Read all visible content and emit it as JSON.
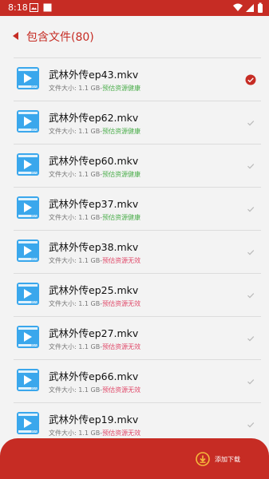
{
  "status_bar": {
    "time": "8:18"
  },
  "header": {
    "title": "包含文件(80)"
  },
  "files": [
    {
      "name": "武林外传ep43.mkv",
      "size_text": "文件大小: 1.1 GB-",
      "health_text": "预估资源健康",
      "health": "ok",
      "checked": true
    },
    {
      "name": "武林外传ep62.mkv",
      "size_text": "文件大小: 1.1 GB-",
      "health_text": "预估资源健康",
      "health": "ok",
      "checked": false
    },
    {
      "name": "武林外传ep60.mkv",
      "size_text": "文件大小: 1.1 GB-",
      "health_text": "预估资源健康",
      "health": "ok",
      "checked": false
    },
    {
      "name": "武林外传ep37.mkv",
      "size_text": "文件大小: 1.1 GB-",
      "health_text": "预估资源健康",
      "health": "ok",
      "checked": false
    },
    {
      "name": "武林外传ep38.mkv",
      "size_text": "文件大小: 1.1 GB-",
      "health_text": "预估资源无效",
      "health": "bad",
      "checked": false
    },
    {
      "name": "武林外传ep25.mkv",
      "size_text": "文件大小: 1.1 GB-",
      "health_text": "预估资源无效",
      "health": "bad",
      "checked": false
    },
    {
      "name": "武林外传ep27.mkv",
      "size_text": "文件大小: 1.1 GB-",
      "health_text": "预估资源无效",
      "health": "bad",
      "checked": false
    },
    {
      "name": "武林外传ep66.mkv",
      "size_text": "文件大小: 1.1 GB-",
      "health_text": "预估资源无效",
      "health": "bad",
      "checked": false
    },
    {
      "name": "武林外传ep19.mkv",
      "size_text": "文件大小: 1.1 GB-",
      "health_text": "预估资源无效",
      "health": "bad",
      "checked": false
    }
  ],
  "file_icon": {
    "name": "mp4-video-file-icon",
    "label": "MP4"
  },
  "footer": {
    "download_label": "添加下载",
    "download_icon": "download-icon"
  },
  "colors": {
    "accent": "#c62c24",
    "healthy": "#4cae4c",
    "invalid": "#e04a6a",
    "file_icon": "#3aa7ec"
  }
}
